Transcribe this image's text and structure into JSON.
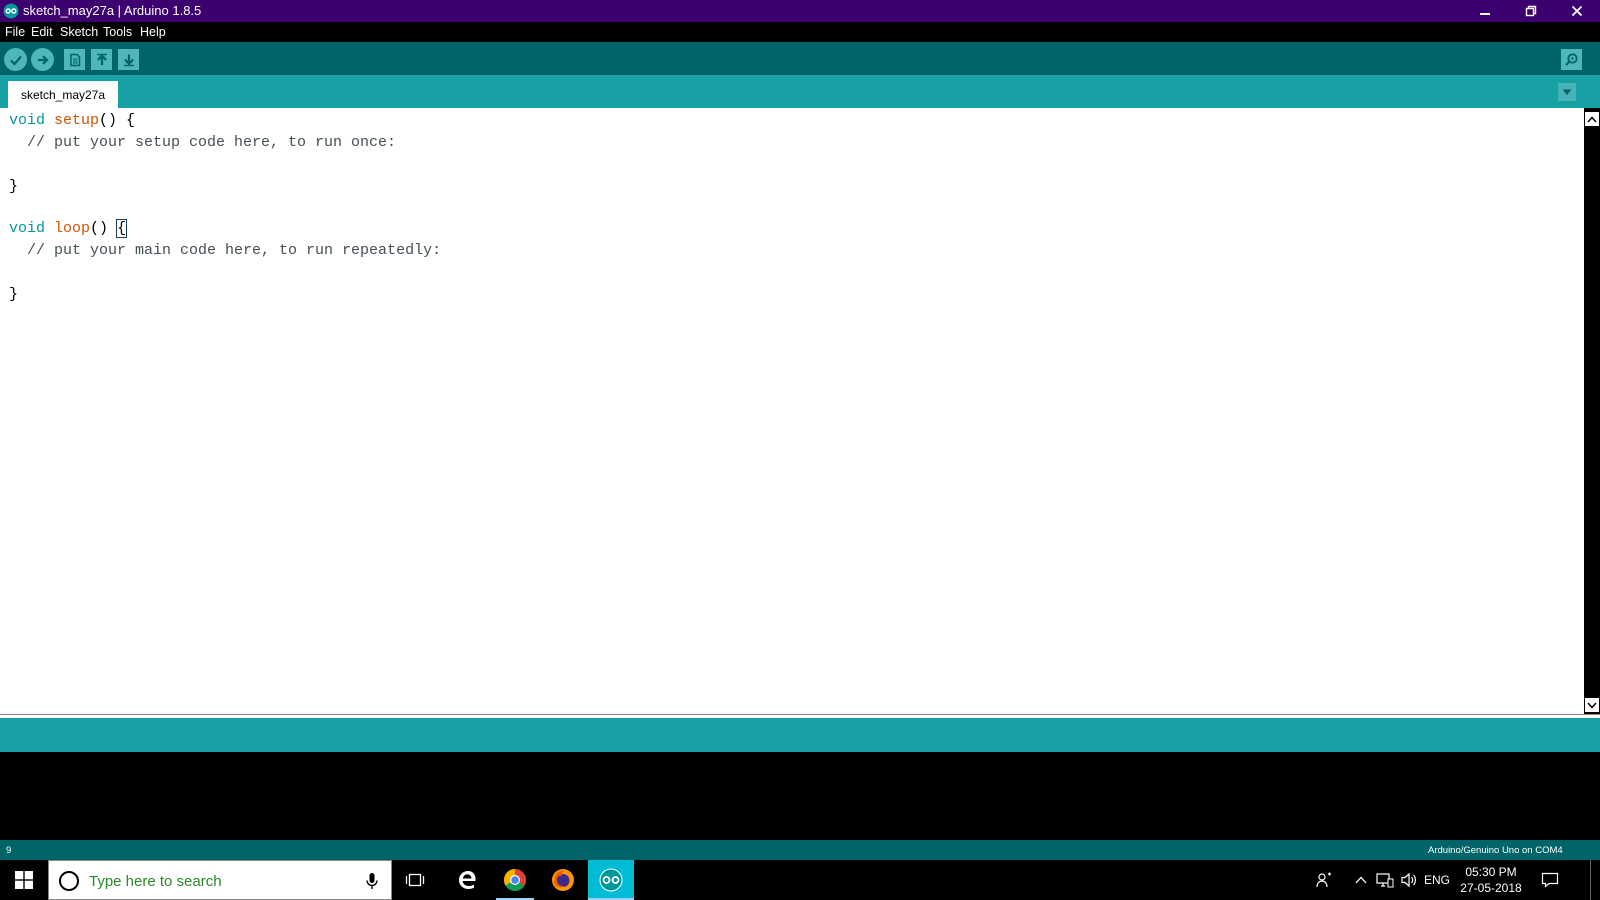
{
  "window": {
    "title": "sketch_may27a | Arduino 1.8.5"
  },
  "menu": [
    "File",
    "Edit",
    "Sketch",
    "Tools",
    "Help"
  ],
  "tabs": [
    {
      "label": "sketch_may27a"
    }
  ],
  "editor": {
    "line1": {
      "kw": "void",
      "fn": "setup",
      "rest": "() {"
    },
    "line2": "  // put your setup code here, to run once:",
    "line4": "}",
    "line6": {
      "kw": "void",
      "fn": "loop",
      "rest": "() ",
      "brace": "{"
    },
    "line7": "  // put your main code here, to run repeatedly:",
    "line9": "}"
  },
  "footer": {
    "line_number": "9",
    "board": "Arduino/Genuino Uno on COM4"
  },
  "taskbar": {
    "search_placeholder": "Type here to search",
    "language": "ENG",
    "time": "05:30 PM",
    "date": "27-05-2018"
  },
  "colors": {
    "titlebar": "#3d006f",
    "toolbar": "#006468",
    "tabstrip": "#17a1a5",
    "keyword": "#00979c",
    "function": "#d35400"
  }
}
